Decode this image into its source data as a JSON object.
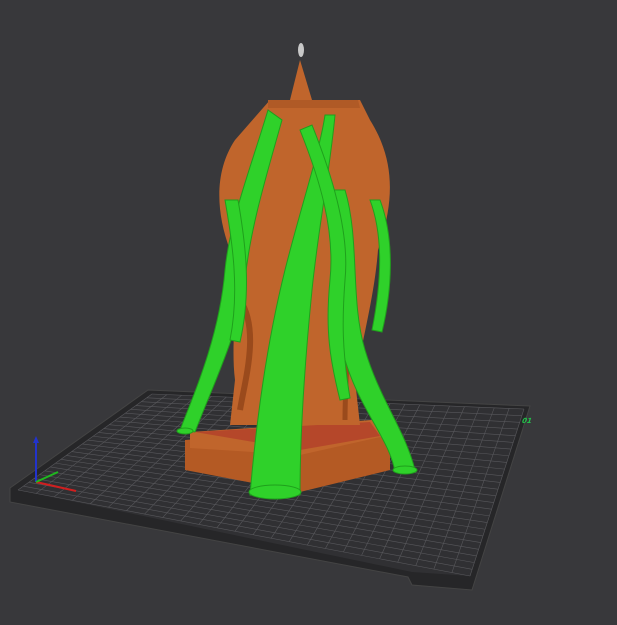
{
  "viewport": {
    "plate_label": "01",
    "colors": {
      "background": "#38383b",
      "bed": "#2c2c2e",
      "grid": "#5a5a5e",
      "model": "#c0652c",
      "support": "#2fd12a",
      "axis_x": "#d01f1f",
      "axis_y": "#1fb81f",
      "axis_z": "#2233cc"
    }
  }
}
